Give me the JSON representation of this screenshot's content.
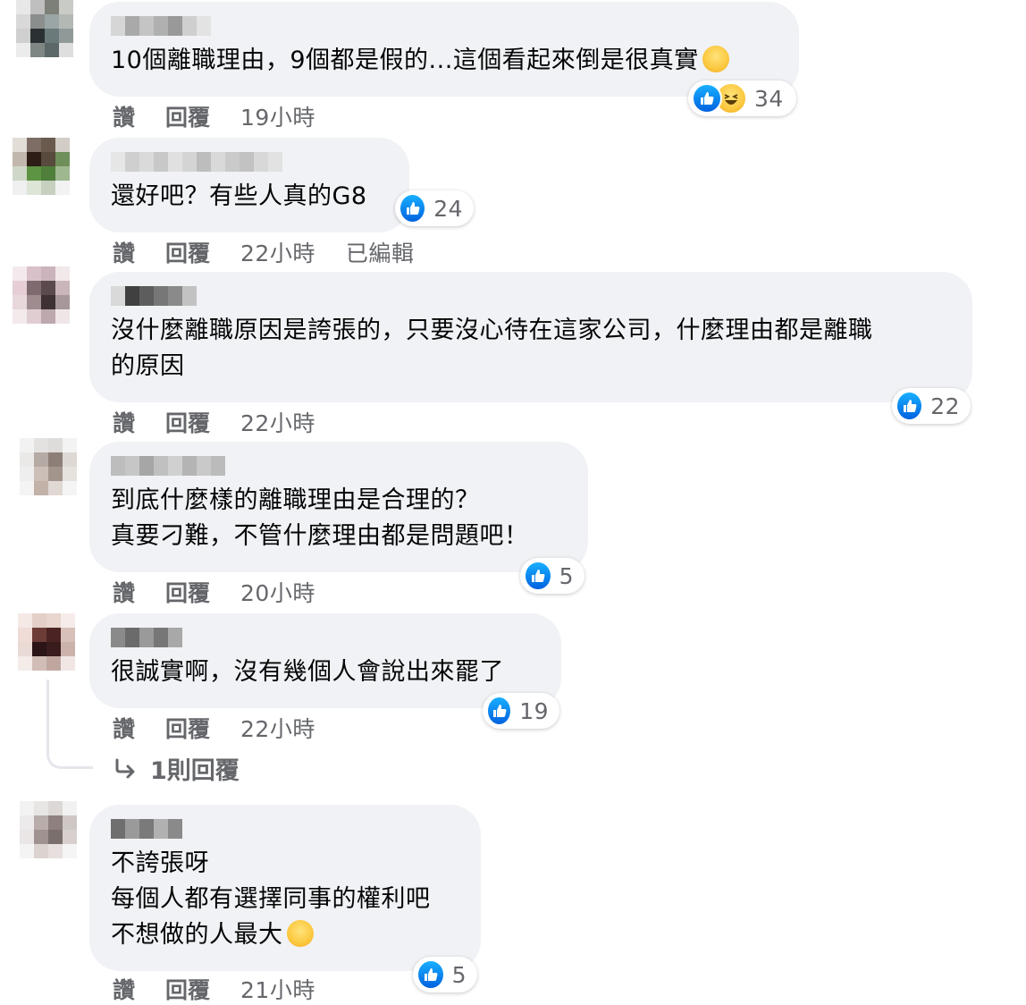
{
  "colors": {
    "bubble": "#f0f2f5",
    "meta_text": "#65676b",
    "like_blue": "#1877f2",
    "haha_yellow": "#fbc83f"
  },
  "actions": {
    "like_label": "讚",
    "reply_label": "回覆",
    "edited_label": "已編輯"
  },
  "comments": [
    {
      "lines": [
        "10個離職理由，9個都是假的...這個看起來倒是很真實"
      ],
      "text_emoji": "rolling-on-floor-laughing-emoji",
      "reaction_icons": [
        "like-icon",
        "haha-icon"
      ],
      "reaction_count": "34",
      "time": "19小時"
    },
    {
      "lines": [
        "還好吧？有些人真的G8"
      ],
      "reaction_icons": [
        "like-icon"
      ],
      "reaction_count": "24",
      "time": "22小時",
      "edited": true
    },
    {
      "lines": [
        "沒什麼離職原因是誇張的，只要沒心待在這家公司，什麼理由都是離職",
        "的原因"
      ],
      "reaction_icons": [
        "like-icon"
      ],
      "reaction_count": "22",
      "time": "22小時"
    },
    {
      "lines": [
        "到底什麼樣的離職理由是合理的？",
        "真要刁難，不管什麼理由都是問題吧！"
      ],
      "reaction_icons": [
        "like-icon"
      ],
      "reaction_count": "5",
      "time": "20小時"
    },
    {
      "lines": [
        "很誠實啊，沒有幾個人會說出來罷了"
      ],
      "reaction_icons": [
        "like-icon"
      ],
      "reaction_count": "19",
      "time": "22小時"
    },
    {
      "lines": [
        "不誇張呀",
        "每個人都有選擇同事的權利吧",
        "不想做的人最大"
      ],
      "text_emoji": "grinning-sweat-emoji",
      "reaction_icons": [
        "like-icon"
      ],
      "reaction_count": "5",
      "time": "21小時"
    }
  ],
  "replies_link": {
    "icon": "reply-arrow-icon",
    "label": "1則回覆"
  }
}
